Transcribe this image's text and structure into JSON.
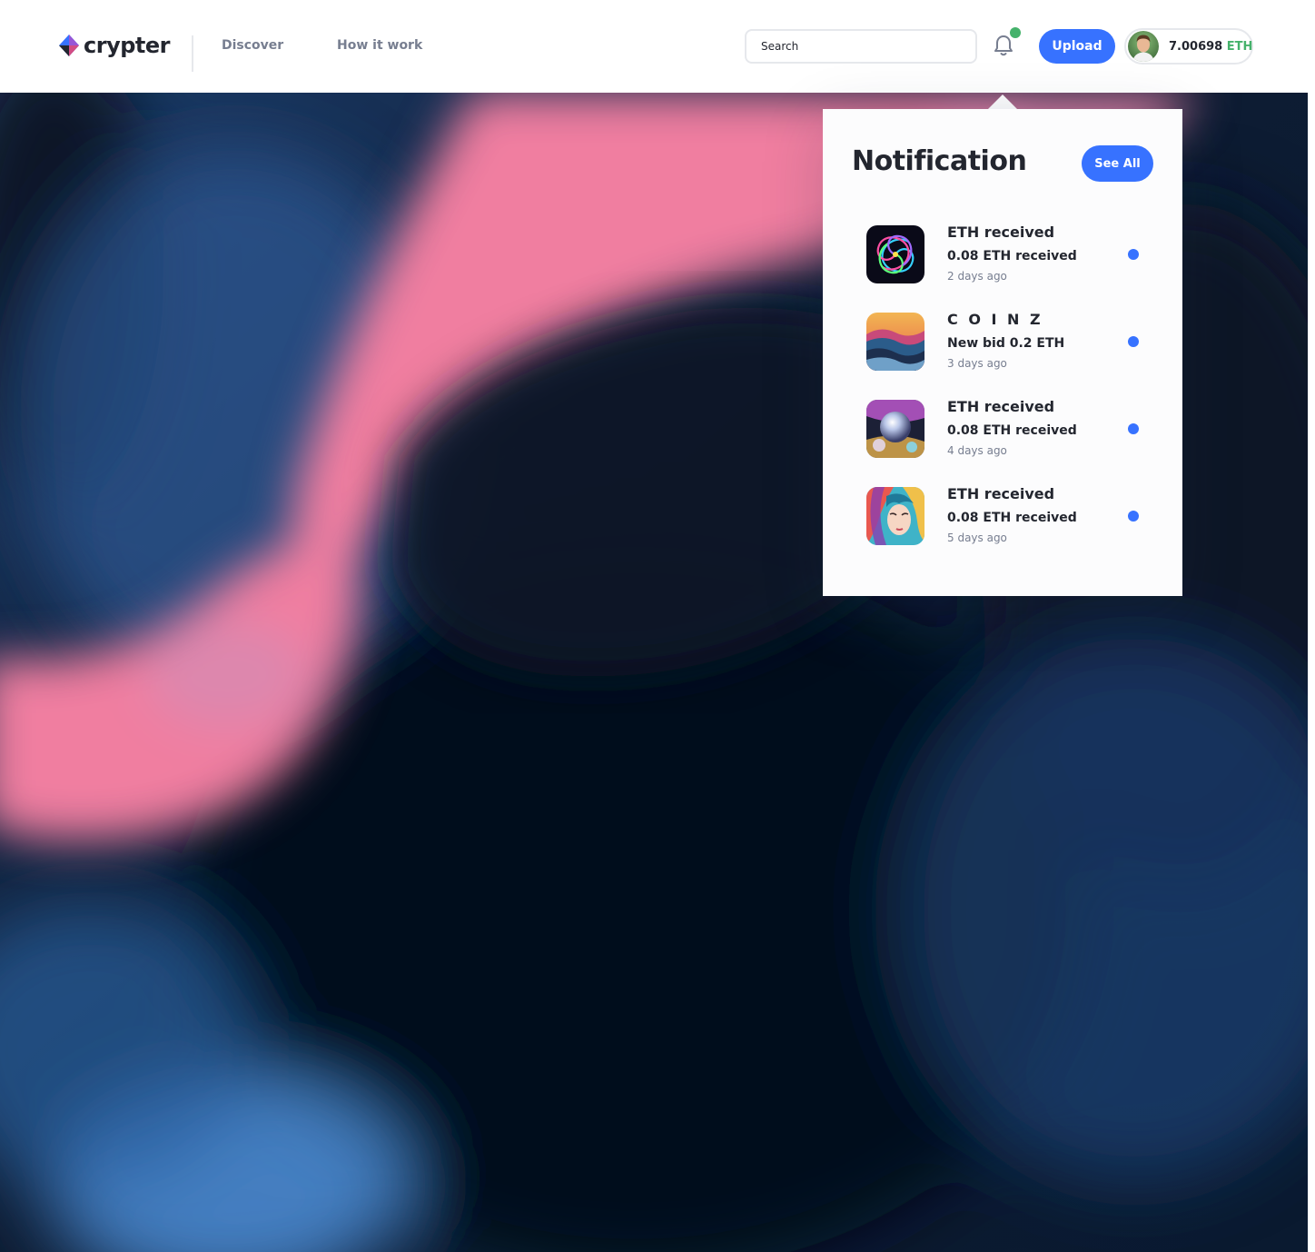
{
  "header": {
    "logo_text": "crypter",
    "nav": [
      {
        "label": "Discover"
      },
      {
        "label": "How it work"
      }
    ],
    "search": {
      "placeholder": "Search"
    },
    "upload_label": "Upload",
    "wallet": {
      "balance": "7.00698",
      "currency": "ETH"
    }
  },
  "notification": {
    "title": "Notification",
    "see_all_label": "See All",
    "items": [
      {
        "title": "ETH received",
        "subtitle": "0.08 ETH received",
        "time": "2 days ago",
        "icon": "swirl-art-thumbnail"
      },
      {
        "title": "C O I N Z",
        "subtitle": "New bid 0.2 ETH",
        "time": "3 days ago",
        "icon": "wave-art-thumbnail"
      },
      {
        "title": "ETH received",
        "subtitle": "0.08 ETH received",
        "time": "4 days ago",
        "icon": "sphere-art-thumbnail"
      },
      {
        "title": "ETH received",
        "subtitle": "0.08 ETH received",
        "time": "5 days ago",
        "icon": "portrait-art-thumbnail"
      }
    ]
  },
  "colors": {
    "accent": "#3772FF",
    "online": "#45B26B",
    "text_dark": "#23262F",
    "text_muted": "#777E90"
  }
}
